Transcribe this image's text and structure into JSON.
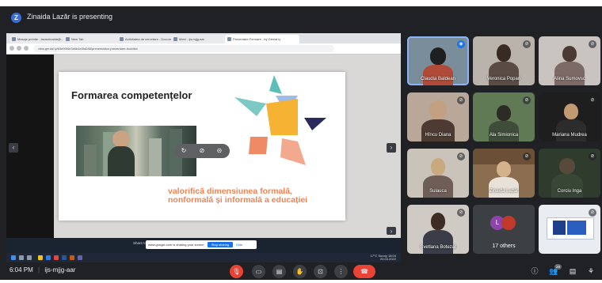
{
  "presenter": {
    "avatar_letter": "Z",
    "text": "Zinaida Lazăr is presenting"
  },
  "browser": {
    "tabs": [
      {
        "label": "Mesaje primite - lazarzinaida@..."
      },
      {
        "label": "New Tab"
      },
      {
        "label": "Activitatea de cercetare - Docum..."
      },
      {
        "label": "Meet - ijs-mjjg-aar"
      },
      {
        "label": "Prezentare Formare - by Genial.ly"
      }
    ],
    "url": "view.genial.ly/6/bf90f4e3d4b4e0fa288/presentation-prezentare-buddish"
  },
  "slide": {
    "title": "Formarea competențelor",
    "body": "valorifică dimensiunea formală, nonformală și informală a educației",
    "colors": {
      "accent_orange": "#ee8455",
      "accent_blue": "#1a73e8"
    }
  },
  "photo_controls": {
    "rotate": "↻",
    "mute": "⊘",
    "more": "⊝"
  },
  "screen_share_banner": {
    "label": "Share to",
    "text": "www.google.com is sharing your screen",
    "stop": "Stop sharing",
    "hide": "Hide"
  },
  "taskbar": {
    "weather": "17°C Sunny",
    "time": "18:04",
    "date": "20.03.2022"
  },
  "participants": [
    {
      "name": "Claudia Baldean",
      "active": true
    },
    {
      "name": "Veronica Popari",
      "active": false
    },
    {
      "name": "Alina Sumovsc",
      "active": false
    },
    {
      "name": "Hîncu Diana",
      "active": false
    },
    {
      "name": "Ala Simionica",
      "active": false
    },
    {
      "name": "Mariana Mudrea",
      "active": false
    },
    {
      "name": "Sulauca",
      "active": false
    },
    {
      "name": "Zinaida Lazăr",
      "active": false
    },
    {
      "name": "Corciu Inga",
      "active": false
    },
    {
      "name": "Svetlana Botezat",
      "active": false
    },
    {
      "name": "17 others",
      "active": false
    },
    {
      "name": "",
      "active": false
    }
  ],
  "others": {
    "letter_a": "L",
    "count_label": "17 others"
  },
  "bottom": {
    "time": "6:04 PM",
    "separator": "|",
    "meeting_code": "ijs-mjjg-aar",
    "controls": [
      "mic-off",
      "camera",
      "captions",
      "raise-hand",
      "present",
      "more",
      "end-call"
    ],
    "participant_count": "29"
  }
}
